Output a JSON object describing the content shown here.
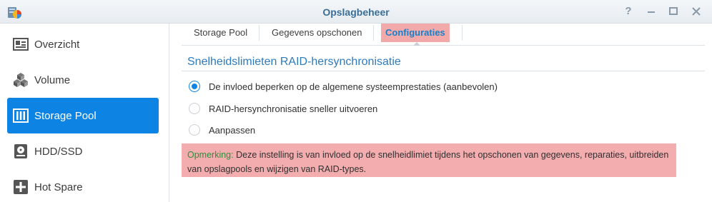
{
  "window": {
    "title": "Opslagbeheer",
    "app_icon": "storage-manager-icon",
    "controls": [
      "help-icon",
      "minimize-icon",
      "maximize-icon",
      "close-icon"
    ]
  },
  "sidebar": {
    "items": [
      {
        "label": "Overzicht",
        "icon": "overview-icon",
        "active": false
      },
      {
        "label": "Volume",
        "icon": "volume-cubes-icon",
        "active": false
      },
      {
        "label": "Storage Pool",
        "icon": "storage-pool-icon",
        "active": true
      },
      {
        "label": "HDD/SSD",
        "icon": "hdd-icon",
        "active": false
      },
      {
        "label": "Hot Spare",
        "icon": "hot-spare-icon",
        "active": false
      }
    ]
  },
  "tabs": [
    {
      "label": "Storage Pool",
      "active": false
    },
    {
      "label": "Gegevens opschonen",
      "active": false
    },
    {
      "label": "Configuraties",
      "active": true
    }
  ],
  "section": {
    "title": "Snelheidslimieten RAID-hersynchronisatie",
    "options": [
      {
        "label": "De invloed beperken op de algemene systeemprestaties (aanbevolen)",
        "checked": true
      },
      {
        "label": "RAID-hersynchronisatie sneller uitvoeren",
        "checked": false
      },
      {
        "label": "Aanpassen",
        "checked": false
      }
    ],
    "note": {
      "prefix": "Opmerking:",
      "text": "Deze instelling is van invloed op de snelheidlimiet tijdens het opschonen van gegevens, reparaties, uitbreiden van opslagpools en wijzigen van RAID-types."
    }
  },
  "colors": {
    "accent": "#0d84e3",
    "title_text": "#3a6e99",
    "section_title": "#2d7bbd",
    "highlight": "#f2a9aa",
    "note_prefix": "#2b8f3a"
  }
}
